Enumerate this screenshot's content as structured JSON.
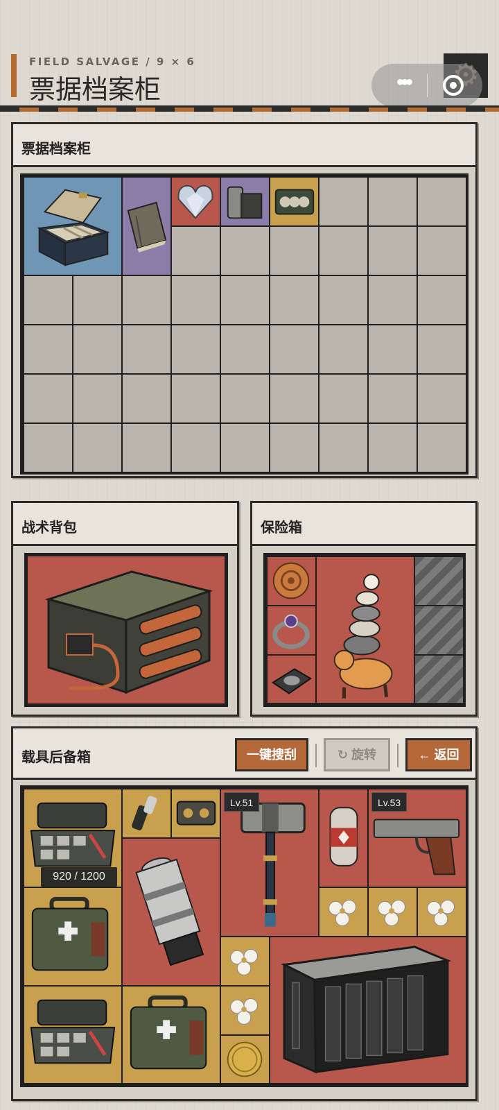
{
  "header": {
    "subtitle": "FIELD SALVAGE / 9 × 6",
    "title": "票据档案柜",
    "menu_glyph": "•••",
    "settings_icon": "gear-icon"
  },
  "ticket_cabinet": {
    "title": "票据档案柜",
    "columns": 9,
    "rows": 6,
    "items": [
      {
        "name": "jewelry-box",
        "rarity": "blue"
      },
      {
        "name": "old-notebook",
        "rarity": "purple"
      },
      {
        "name": "diamond-heart",
        "rarity": "red"
      },
      {
        "name": "metal-canister",
        "rarity": "purple"
      },
      {
        "name": "film-reel-case",
        "rarity": "gold"
      }
    ]
  },
  "backpack": {
    "title": "战术背包",
    "item": {
      "name": "battery-pack",
      "rarity": "red"
    }
  },
  "safe_box": {
    "title": "保险箱",
    "items": [
      {
        "name": "mooncake",
        "rarity": "red"
      },
      {
        "name": "gem-ring",
        "rarity": "red"
      },
      {
        "name": "hard-drive",
        "rarity": "red"
      },
      {
        "name": "stacked-cats",
        "rarity": "red"
      }
    ],
    "locked_slots": 3
  },
  "trunk": {
    "title": "载具后备箱",
    "buttons": {
      "search_all": "一键搜刮",
      "rotate": "旋转",
      "back": "返回"
    },
    "durability": "920 / 1200",
    "hammer_level": "Lv.51",
    "pistol_level": "Lv.53",
    "items": [
      {
        "name": "tool-case",
        "rarity": "gold"
      },
      {
        "name": "flashlight-bundle",
        "rarity": "gold"
      },
      {
        "name": "tape-deck",
        "rarity": "gold"
      },
      {
        "name": "war-hammer",
        "rarity": "red"
      },
      {
        "name": "medicine-capsule",
        "rarity": "red"
      },
      {
        "name": "pistol",
        "rarity": "red"
      },
      {
        "name": "turbine-engine",
        "rarity": "red"
      },
      {
        "name": "flower",
        "rarity": "gold"
      },
      {
        "name": "medical-kit",
        "rarity": "gold"
      },
      {
        "name": "server-nas",
        "rarity": "red"
      },
      {
        "name": "gold-coin",
        "rarity": "gold"
      }
    ]
  },
  "colors": {
    "accent": "#b56a32",
    "rarity_blue": "#6f96b5",
    "rarity_purple": "#8b7da8",
    "rarity_red": "#b8574c",
    "rarity_gold": "#c9a04e"
  }
}
